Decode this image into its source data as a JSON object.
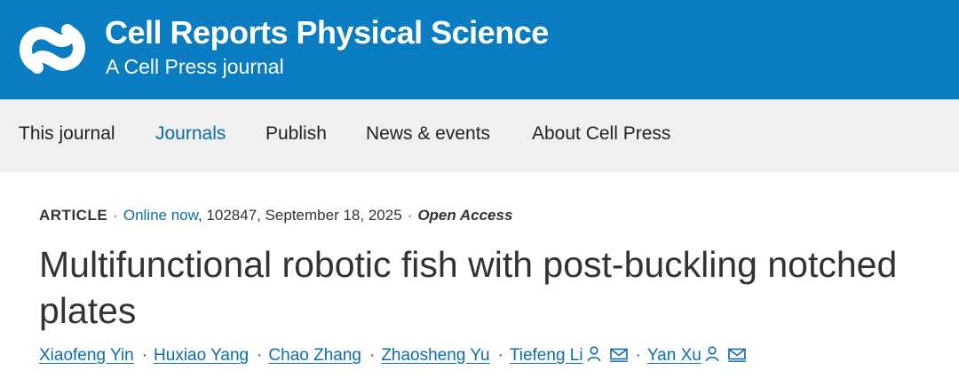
{
  "header": {
    "journal_title": "Cell Reports Physical Science",
    "subtitle": "A Cell Press journal",
    "brand_color": "#0a7cc1",
    "logo_icon": "cell-press-logo-icon"
  },
  "nav": {
    "items": [
      {
        "label": "This journal"
      },
      {
        "label": "Journals"
      },
      {
        "label": "Publish"
      },
      {
        "label": "News & events"
      },
      {
        "label": "About Cell Press"
      }
    ],
    "active_label": "Journals",
    "background": "#f0f0f0"
  },
  "article": {
    "type": "ARTICLE",
    "status_link": "Online now",
    "details": ", 102847, September 18, 2025",
    "access": "Open Access",
    "title": "Multifunctional robotic fish with post-buckling notched plates",
    "authors": [
      {
        "name": "Xiaofeng Yin"
      },
      {
        "name": "Huxiao Yang"
      },
      {
        "name": "Chao Zhang"
      },
      {
        "name": "Zhaosheng Yu"
      },
      {
        "name": "Tiefeng Li",
        "icons": [
          "person-icon",
          "mail-icon"
        ]
      },
      {
        "name": "Yan Xu",
        "icons": [
          "person-icon",
          "mail-icon"
        ]
      }
    ],
    "separator": "·",
    "link_color": "#0a6ea8"
  }
}
